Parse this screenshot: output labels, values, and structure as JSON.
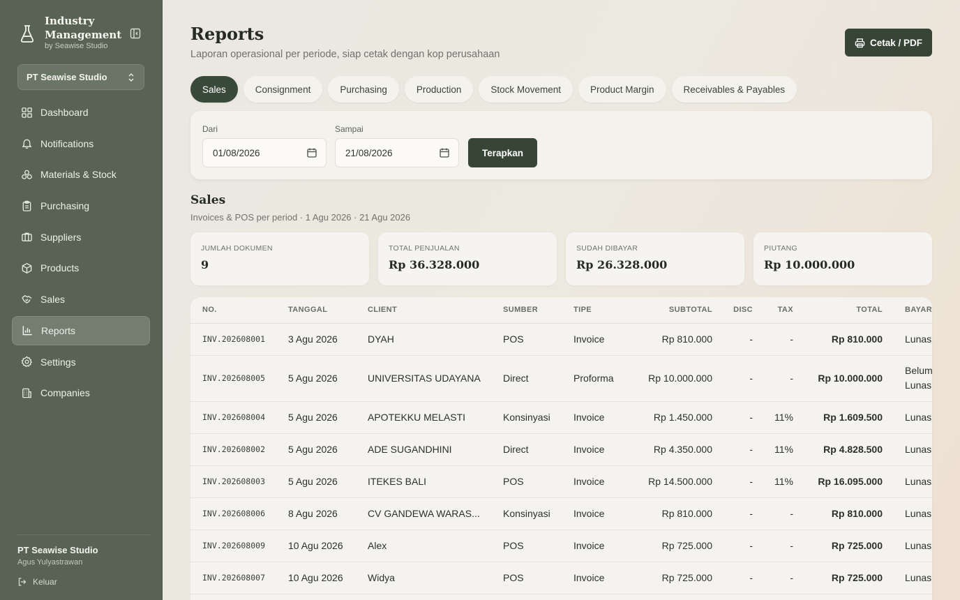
{
  "brand": {
    "title": "Industry Management",
    "subtitle": "by Seawise Studio"
  },
  "company_select": "PT Seawise Studio",
  "nav": [
    {
      "label": "Dashboard",
      "icon": "grid-icon",
      "active": false
    },
    {
      "label": "Notifications",
      "icon": "bell-icon",
      "active": false
    },
    {
      "label": "Materials & Stock",
      "icon": "boxes-icon",
      "active": false
    },
    {
      "label": "Purchasing",
      "icon": "clipboard-icon",
      "active": false
    },
    {
      "label": "Suppliers",
      "icon": "briefcase-icon",
      "active": false
    },
    {
      "label": "Products",
      "icon": "package-icon",
      "active": false
    },
    {
      "label": "Sales",
      "icon": "handshake-icon",
      "active": false
    },
    {
      "label": "Reports",
      "icon": "bar-chart-icon",
      "active": true
    },
    {
      "label": "Settings",
      "icon": "gear-icon",
      "active": false
    },
    {
      "label": "Companies",
      "icon": "building-icon",
      "active": false
    }
  ],
  "footer": {
    "company": "PT Seawise Studio",
    "user": "Agus Yulyastrawan",
    "logout": "Keluar"
  },
  "header": {
    "title": "Reports",
    "subtitle": "Laporan operasional per periode, siap cetak dengan kop perusahaan",
    "print_label": "Cetak / PDF"
  },
  "tabs": [
    {
      "label": "Sales",
      "active": true
    },
    {
      "label": "Consignment",
      "active": false
    },
    {
      "label": "Purchasing",
      "active": false
    },
    {
      "label": "Production",
      "active": false
    },
    {
      "label": "Stock Movement",
      "active": false
    },
    {
      "label": "Product Margin",
      "active": false
    },
    {
      "label": "Receivables & Payables",
      "active": false
    }
  ],
  "filter": {
    "from_label": "Dari",
    "from_value": "01/08/2026",
    "to_label": "Sampai",
    "to_value": "21/08/2026",
    "apply_label": "Terapkan"
  },
  "section": {
    "title": "Sales",
    "subtitle": "Invoices & POS per period · 1 Agu 2026 · 21 Agu 2026"
  },
  "stats": [
    {
      "label": "JUMLAH DOKUMEN",
      "value": "9"
    },
    {
      "label": "TOTAL PENJUALAN",
      "value": "Rp 36.328.000"
    },
    {
      "label": "SUDAH DIBAYAR",
      "value": "Rp 26.328.000"
    },
    {
      "label": "PIUTANG",
      "value": "Rp 10.000.000"
    }
  ],
  "table": {
    "columns": [
      "NO.",
      "TANGGAL",
      "CLIENT",
      "SUMBER",
      "TIPE",
      "SUBTOTAL",
      "DISC",
      "TAX",
      "TOTAL",
      "BAYAR"
    ],
    "rows": [
      [
        "INV.202608001",
        "3 Agu 2026",
        "DYAH",
        "POS",
        "Invoice",
        "Rp 810.000",
        "-",
        "-",
        "Rp 810.000",
        "Lunas"
      ],
      [
        "INV.202608005",
        "5 Agu 2026",
        "UNIVERSITAS UDAYANA",
        "Direct",
        "Proforma",
        "Rp 10.000.000",
        "-",
        "-",
        "Rp 10.000.000",
        "Belum Lunas"
      ],
      [
        "INV.202608004",
        "5 Agu 2026",
        "APOTEKKU MELASTI",
        "Konsinyasi",
        "Invoice",
        "Rp 1.450.000",
        "-",
        "11%",
        "Rp 1.609.500",
        "Lunas"
      ],
      [
        "INV.202608002",
        "5 Agu 2026",
        "ADE SUGANDHINI",
        "Direct",
        "Invoice",
        "Rp 4.350.000",
        "-",
        "11%",
        "Rp 4.828.500",
        "Lunas"
      ],
      [
        "INV.202608003",
        "5 Agu 2026",
        "ITEKES BALI",
        "POS",
        "Invoice",
        "Rp 14.500.000",
        "-",
        "11%",
        "Rp 16.095.000",
        "Lunas"
      ],
      [
        "INV.202608006",
        "8 Agu 2026",
        "CV GANDEWA WARAS...",
        "Konsinyasi",
        "Invoice",
        "Rp 810.000",
        "-",
        "-",
        "Rp 810.000",
        "Lunas"
      ],
      [
        "INV.202608009",
        "10 Agu 2026",
        "Alex",
        "POS",
        "Invoice",
        "Rp 725.000",
        "-",
        "-",
        "Rp 725.000",
        "Lunas"
      ],
      [
        "INV.202608007",
        "10 Agu 2026",
        "Widya",
        "POS",
        "Invoice",
        "Rp 725.000",
        "-",
        "-",
        "Rp 725.000",
        "Lunas"
      ]
    ]
  }
}
